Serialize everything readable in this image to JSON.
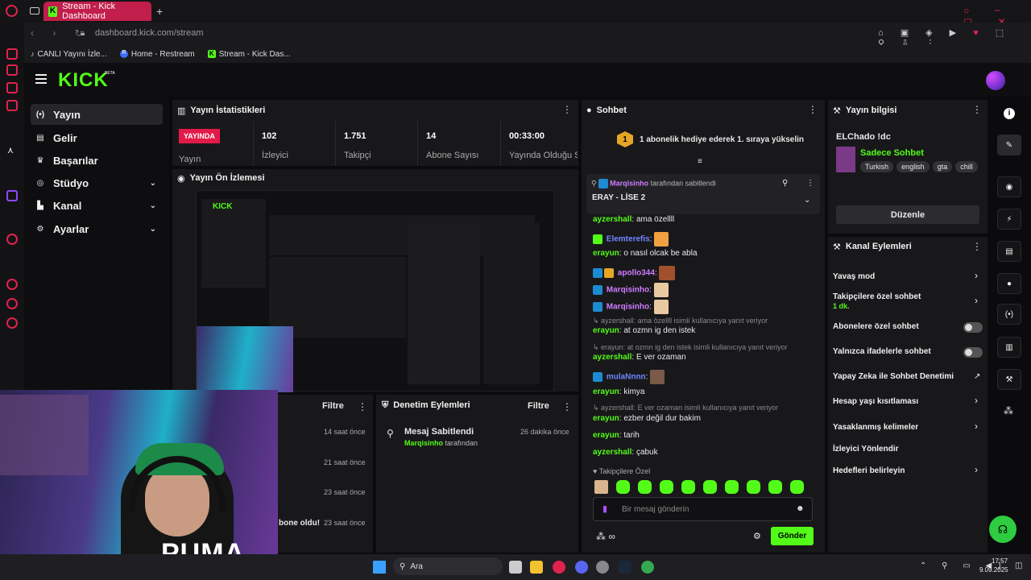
{
  "browser": {
    "tab_title": "Stream - Kick Dashboard",
    "url": "dashboard.kick.com/stream",
    "bookmarks": [
      "CANLI Yayını İzle...",
      "Home - Restream",
      "Stream - Kick Das..."
    ]
  },
  "brand": {
    "logo": "KICK",
    "beta": "BETA",
    "accent": "#53fc18"
  },
  "sidebar": {
    "items": [
      {
        "label": "Yayın",
        "icon": "broadcast-icon"
      },
      {
        "label": "Gelir",
        "icon": "revenue-icon"
      },
      {
        "label": "Başarılar",
        "icon": "trophy-icon"
      },
      {
        "label": "Stüdyo",
        "icon": "studio-icon"
      },
      {
        "label": "Kanal",
        "icon": "channel-icon"
      },
      {
        "label": "Ayarlar",
        "icon": "gear-icon"
      }
    ]
  },
  "stats": {
    "title": "Yayın İstatistikleri",
    "live_label": "YAYINDA",
    "live_caption": "Yayın",
    "items": [
      {
        "value": "102",
        "label": "İzleyici"
      },
      {
        "value": "1.751",
        "label": "Takipçi"
      },
      {
        "value": "14",
        "label": "Abone Sayısı"
      },
      {
        "value": "00:33:00",
        "label": "Yayında Olduğu Süre"
      }
    ]
  },
  "preview": {
    "title": "Yayın Ön İzlemesi"
  },
  "activity": {
    "filter": "Filtre",
    "times": [
      "14 saat önce",
      "21 saat önce",
      "23 saat önce",
      "23 saat önce"
    ],
    "partial_text": "bone oldu!"
  },
  "moderation": {
    "title": "Denetim Eylemleri",
    "filter": "Filtre",
    "event": "Mesaj Sabitlendi",
    "user": "Marqisinho",
    "by": "tarafından",
    "time": "26 dakika önce"
  },
  "chat": {
    "title": "Sohbet",
    "promo": "1 abonelik hediye ederek 1. sıraya yükselin",
    "promo_rank": "1",
    "pinned_user": "Marqisinho",
    "pinned_by": "tarafından sabitlendi",
    "pinned_msg": "ERAY - LİSE 2",
    "messages": [
      {
        "user": "ayzershall",
        "text": "ama özellll"
      },
      {
        "user": "Elemterefis",
        "text": ""
      },
      {
        "user": "erayun",
        "text": "o nasıl olcak be abla"
      },
      {
        "user": "apollo344",
        "text": ""
      },
      {
        "user": "Marqisinho",
        "text": ""
      },
      {
        "user": "Marqisinho",
        "text": ""
      },
      {
        "reply": "ayzershall: ama özellll isimli kullanıcıya yanıt veriyor"
      },
      {
        "user": "erayun",
        "text": "at ozmn ig den istek"
      },
      {
        "reply": "erayun: at ozmn ig den istek isimli kullanıcıya yanıt veriyor"
      },
      {
        "user": "ayzershall",
        "text": "E ver ozaman"
      },
      {
        "user": "mulaNnnn",
        "text": ""
      },
      {
        "user": "erayun",
        "text": "kimya"
      },
      {
        "reply": "ayzershall: E ver ozaman isimli kullanıcıya yanıt veriyor"
      },
      {
        "user": "erayun",
        "text": "ezber değil dur bakim"
      },
      {
        "user": "erayun",
        "text": "tarih"
      },
      {
        "user": "ayzershall",
        "text": "çabuk"
      }
    ],
    "followers_only": "Takipçilere Özel",
    "input_placeholder": "Bir mesaj gönderin",
    "send": "Gönder"
  },
  "stream_info": {
    "title": "Yayın bilgisi",
    "name": "ELChado !dc",
    "category": "Sadece Sohbet",
    "tags": [
      "Turkish",
      "english",
      "gta",
      "chill"
    ],
    "edit": "Düzenle"
  },
  "channel_actions": {
    "title": "Kanal Eylemleri",
    "items": [
      {
        "label": "Yavaş mod"
      },
      {
        "label": "Takipçilere özel sohbet",
        "sub": "1 dk."
      },
      {
        "label": "Abonelere özel sohbet"
      },
      {
        "label": "Yalnızca ifadelerle sohbet"
      },
      {
        "label": "Yapay Zeka ile Sohbet Denetimi"
      },
      {
        "label": "Hesap yaşı kısıtlaması"
      },
      {
        "label": "Yasaklanmış kelimeler"
      },
      {
        "label": "İzleyici Yönlendir"
      },
      {
        "label": "Hedefleri belirleyin"
      }
    ]
  },
  "taskbar": {
    "search": "Ara",
    "time": "17:57",
    "date": "9.09.2025"
  }
}
